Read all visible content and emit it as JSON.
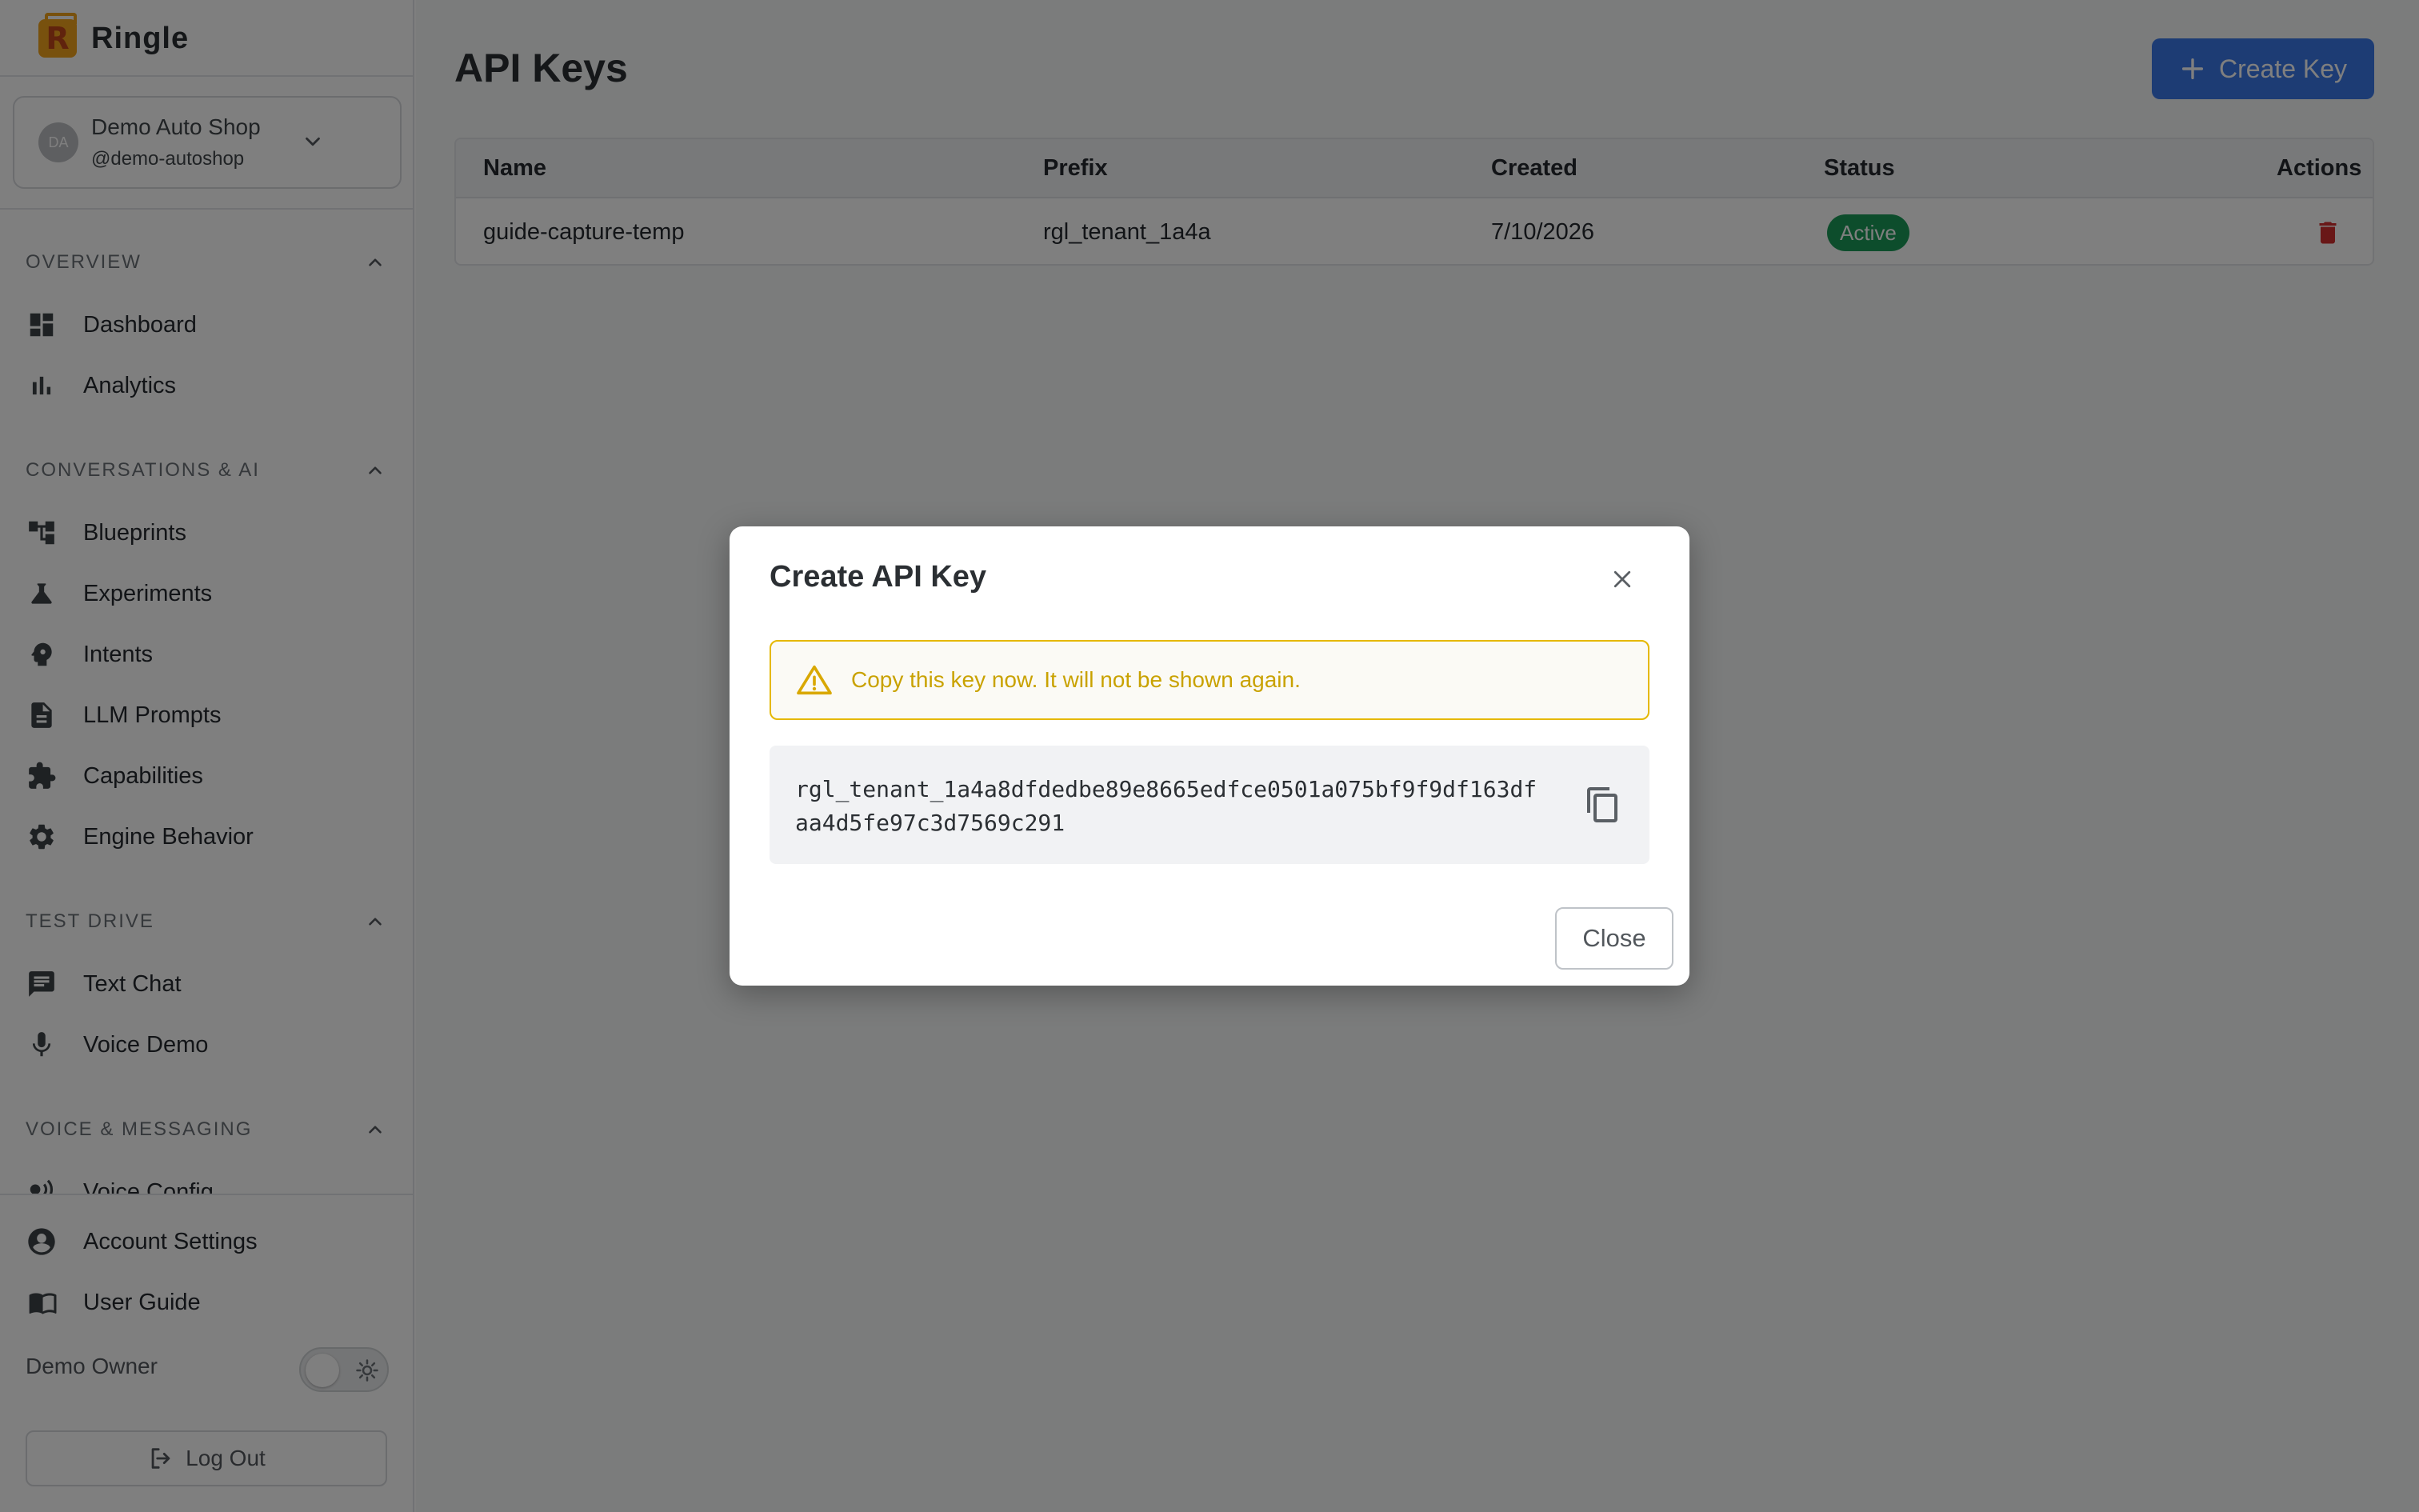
{
  "app": {
    "name": "Ringle",
    "logo_letter": "R"
  },
  "tenant": {
    "initials": "DA",
    "name": "Demo Auto Shop",
    "handle": "@demo-autoshop"
  },
  "sidebar": {
    "sections": [
      {
        "title": "OVERVIEW",
        "items": [
          {
            "label": "Dashboard",
            "icon": "dashboard-icon"
          },
          {
            "label": "Analytics",
            "icon": "bar-chart-icon"
          }
        ]
      },
      {
        "title": "CONVERSATIONS & AI",
        "items": [
          {
            "label": "Blueprints",
            "icon": "blueprint-tree-icon"
          },
          {
            "label": "Experiments",
            "icon": "flask-icon"
          },
          {
            "label": "Intents",
            "icon": "brain-head-icon"
          },
          {
            "label": "LLM Prompts",
            "icon": "document-icon"
          },
          {
            "label": "Capabilities",
            "icon": "puzzle-icon"
          },
          {
            "label": "Engine Behavior",
            "icon": "gear-icon"
          }
        ]
      },
      {
        "title": "TEST DRIVE",
        "items": [
          {
            "label": "Text Chat",
            "icon": "chat-icon"
          },
          {
            "label": "Voice Demo",
            "icon": "microphone-icon"
          }
        ]
      },
      {
        "title": "VOICE & MESSAGING",
        "items": [
          {
            "label": "Voice Config",
            "icon": "voice-config-icon"
          }
        ]
      }
    ],
    "footer_items": [
      {
        "label": "Account Settings",
        "icon": "account-icon"
      },
      {
        "label": "User Guide",
        "icon": "book-icon"
      }
    ],
    "owner_label": "Demo Owner",
    "logout_label": "Log Out"
  },
  "page": {
    "title": "API Keys",
    "create_button_label": "Create Key",
    "table": {
      "columns": [
        "Name",
        "Prefix",
        "Created",
        "Status",
        "Actions"
      ],
      "rows": [
        {
          "name": "guide-capture-temp",
          "prefix": "rgl_tenant_1a4a",
          "created": "7/10/2026",
          "status": "Active"
        }
      ]
    }
  },
  "modal": {
    "title": "Create API Key",
    "warning": "Copy this key now. It will not be shown again.",
    "key": "rgl_tenant_1a4a8dfdedbe89e8665edfce0501a075bf9f9df163dfaa4d5fe97c3d7569c291",
    "close_label": "Close"
  },
  "colors": {
    "primary": "#3b79e8",
    "active_badge": "#1b9a58",
    "warning": "#e5b800",
    "danger": "#d32f2f",
    "brand": "#f0a21c"
  }
}
